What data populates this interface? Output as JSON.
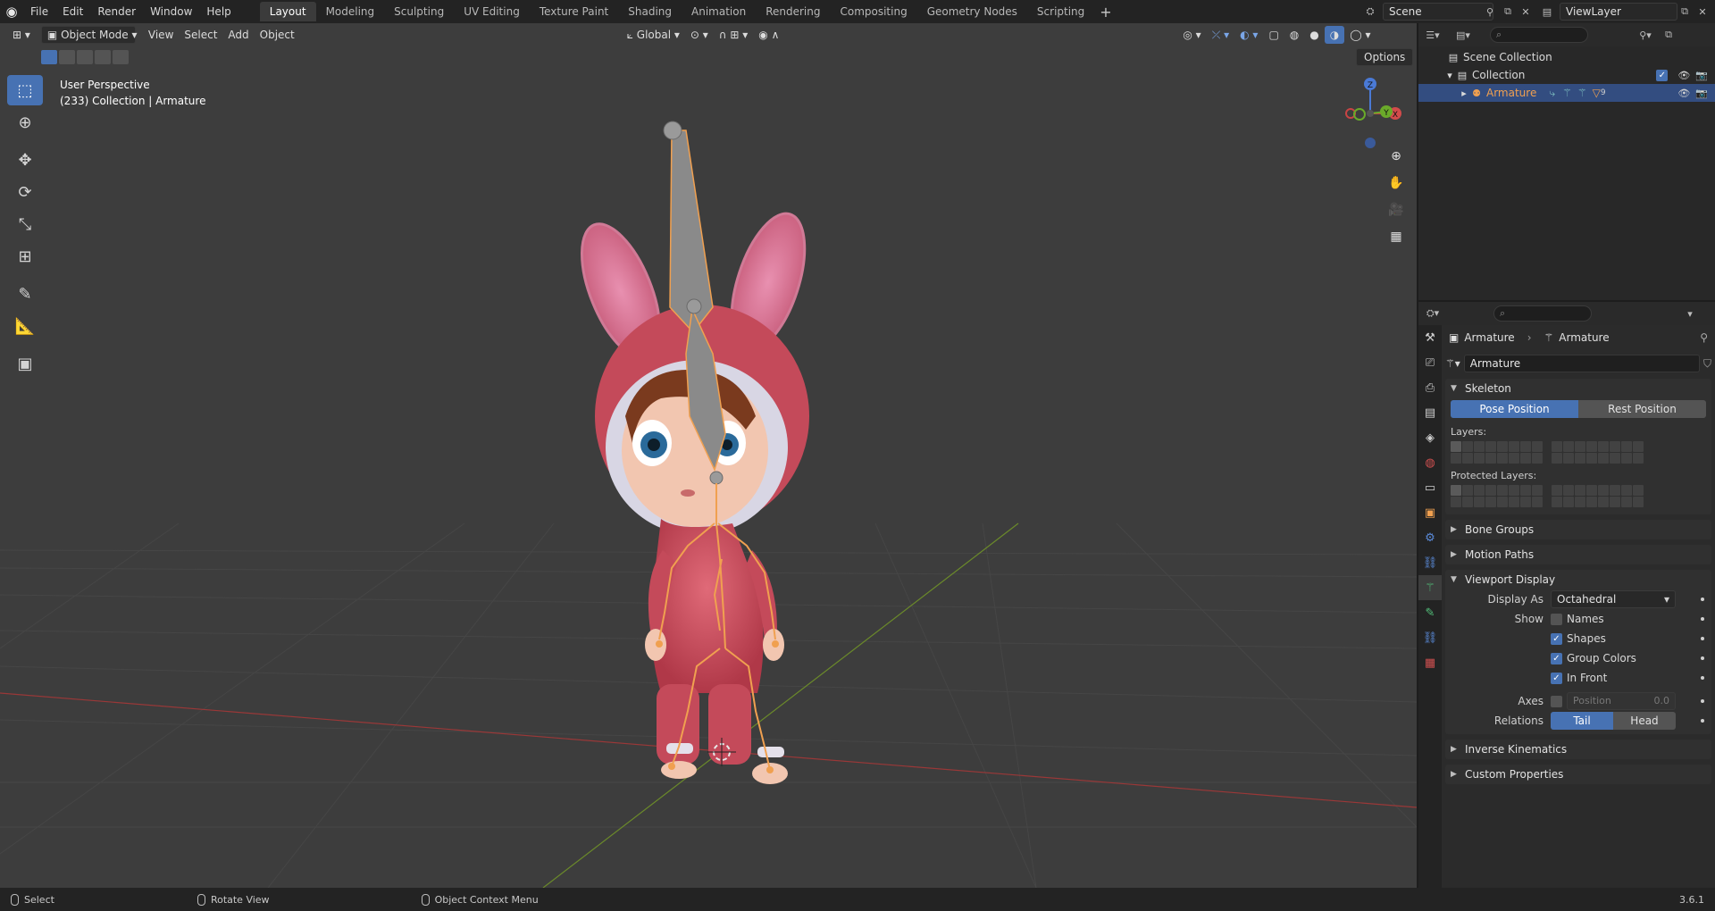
{
  "menubar": {
    "items": [
      "File",
      "Edit",
      "Render",
      "Window",
      "Help"
    ],
    "workspaces": [
      "Layout",
      "Modeling",
      "Sculpting",
      "UV Editing",
      "Texture Paint",
      "Shading",
      "Animation",
      "Rendering",
      "Compositing",
      "Geometry Nodes",
      "Scripting"
    ],
    "active_workspace": "Layout",
    "add_tab": "+",
    "scene": "Scene",
    "view_layer": "ViewLayer"
  },
  "viewport": {
    "mode": "Object Mode",
    "menus": [
      "View",
      "Select",
      "Add",
      "Object"
    ],
    "orientation": "Global",
    "options": "Options",
    "overlay_line1": "User Perspective",
    "overlay_line2": "(233) Collection | Armature",
    "gizmo_axes": {
      "z": "Z",
      "y": "Y",
      "x": "X"
    }
  },
  "outliner": {
    "search_placeholder": "",
    "rows": [
      {
        "label": "Scene Collection"
      },
      {
        "label": "Collection"
      },
      {
        "label": "Armature",
        "badge": "9"
      }
    ]
  },
  "properties": {
    "breadcrumb_object": "Armature",
    "breadcrumb_data": "Armature",
    "data_name": "Armature",
    "skeleton": {
      "title": "Skeleton",
      "pose_position": "Pose Position",
      "rest_position": "Rest Position",
      "layers_label": "Layers:",
      "protected_label": "Protected Layers:"
    },
    "collapsed_panels": [
      "Bone Groups",
      "Motion Paths"
    ],
    "viewport_display": {
      "title": "Viewport Display",
      "display_as_label": "Display As",
      "display_as_value": "Octahedral",
      "show_label": "Show",
      "names": "Names",
      "shapes": "Shapes",
      "group_colors": "Group Colors",
      "in_front": "In Front",
      "axes_label": "Axes",
      "axes_position_label": "Position",
      "axes_position_value": "0.0",
      "relations_label": "Relations",
      "tail": "Tail",
      "head": "Head"
    },
    "bottom_panels": [
      "Inverse Kinematics",
      "Custom Properties"
    ]
  },
  "statusbar": {
    "select": "Select",
    "rotate": "Rotate View",
    "context": "Object Context Menu",
    "version": "3.6.1"
  },
  "colors": {
    "accent": "#4772b3",
    "selected_row": "#334d80",
    "bone_orange": "#f0a050",
    "grid_x": "#a33a3a",
    "grid_y": "#6b8a2a"
  }
}
